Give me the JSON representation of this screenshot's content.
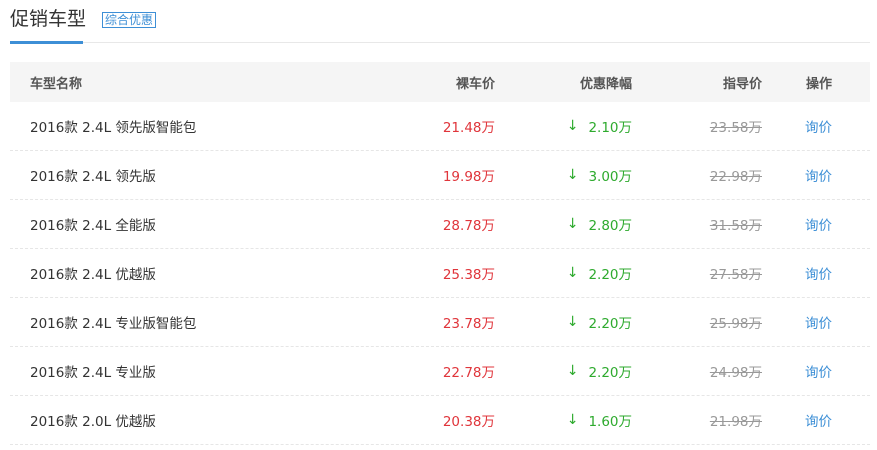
{
  "header": {
    "title": "促销车型",
    "tag": "综合优惠"
  },
  "table": {
    "columns": {
      "name": "车型名称",
      "price": "裸车价",
      "discount": "优惠降幅",
      "guide": "指导价",
      "action": "操作"
    },
    "rows": [
      {
        "name": "2016款 2.4L 领先版智能包",
        "price": "21.48万",
        "discount": "2.10万",
        "guide": "23.58万",
        "action": "询价"
      },
      {
        "name": "2016款 2.4L 领先版",
        "price": "19.98万",
        "discount": "3.00万",
        "guide": "22.98万",
        "action": "询价"
      },
      {
        "name": "2016款 2.4L 全能版",
        "price": "28.78万",
        "discount": "2.80万",
        "guide": "31.58万",
        "action": "询价"
      },
      {
        "name": "2016款 2.4L 优越版",
        "price": "25.38万",
        "discount": "2.20万",
        "guide": "27.58万",
        "action": "询价"
      },
      {
        "name": "2016款 2.4L 专业版智能包",
        "price": "23.78万",
        "discount": "2.20万",
        "guide": "25.98万",
        "action": "询价"
      },
      {
        "name": "2016款 2.4L 专业版",
        "price": "22.78万",
        "discount": "2.20万",
        "guide": "24.98万",
        "action": "询价"
      },
      {
        "name": "2016款 2.0L 优越版",
        "price": "20.38万",
        "discount": "1.60万",
        "guide": "21.98万",
        "action": "询价"
      }
    ]
  },
  "icons": {
    "discount_arrow": "arrow-down-icon"
  },
  "colors": {
    "accent": "#3d8fd6",
    "price": "#e0353b",
    "discount": "#2eaa2e",
    "muted": "#999999"
  }
}
